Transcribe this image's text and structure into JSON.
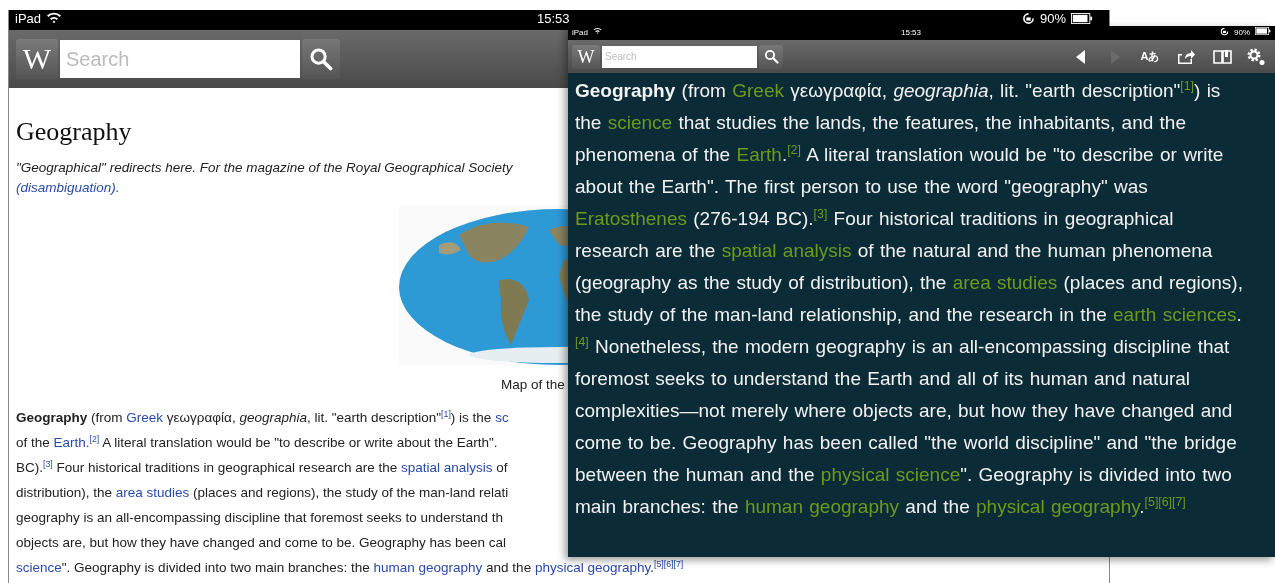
{
  "back_screen": {
    "status_bar": {
      "device": "iPad",
      "time": "15:53",
      "battery": "90%"
    },
    "toolbar": {
      "logo": "W",
      "search": {
        "placeholder": "Search"
      }
    },
    "article": {
      "title": "Geography",
      "hatnote": [
        {
          "kind": "text",
          "text": "\"Geographical\" redirects here. For the magazine of the Royal Geographical Society"
        }
      ],
      "hatnote_link": [
        {
          "kind": "text",
          "text": "(disambiguation)."
        }
      ],
      "figure": {
        "kind": "picture",
        "caption": "Map of the"
      },
      "lines": [
        [
          {
            "kind": "bold",
            "text": "Geography"
          },
          {
            "kind": "text",
            "text": " (from "
          },
          {
            "kind": "link",
            "text": "Greek"
          },
          {
            "kind": "text",
            "text": " γεωγραφία, "
          },
          {
            "kind": "italic",
            "text": "geographia"
          },
          {
            "kind": "text",
            "text": ", lit. \"earth description\""
          },
          {
            "kind": "ref",
            "text": "[1]"
          },
          {
            "kind": "text",
            "text": ") is the "
          },
          {
            "kind": "link",
            "text": "sc"
          }
        ],
        [
          {
            "kind": "text",
            "text": "of the "
          },
          {
            "kind": "link",
            "text": "Earth."
          },
          {
            "kind": "ref",
            "text": "[2]"
          },
          {
            "kind": "text",
            "text": " A literal translation would be \"to describe or write about the Earth\"."
          }
        ],
        [
          {
            "kind": "text",
            "text": "BC)."
          },
          {
            "kind": "ref",
            "text": "[3]"
          },
          {
            "kind": "text",
            "text": " Four historical traditions in geographical research are the "
          },
          {
            "kind": "link",
            "text": "spatial analysis"
          },
          {
            "kind": "text",
            "text": " of"
          }
        ],
        [
          {
            "kind": "text",
            "text": "distribution), the "
          },
          {
            "kind": "link",
            "text": "area studies"
          },
          {
            "kind": "text",
            "text": " (places and regions), the study of the man-land relati"
          }
        ],
        [
          {
            "kind": "text",
            "text": "geography is an all-encompassing discipline that foremost seeks to understand th"
          }
        ],
        [
          {
            "kind": "text",
            "text": "objects are, but how they have changed and come to be. Geography has been cal"
          }
        ],
        [
          {
            "kind": "link",
            "text": "science"
          },
          {
            "kind": "text",
            "text": "\". Geography is divided into two main branches: the "
          },
          {
            "kind": "link",
            "text": "human geography"
          },
          {
            "kind": "text",
            "text": " and the "
          },
          {
            "kind": "link",
            "text": "physical geography"
          },
          {
            "kind": "text",
            "text": "."
          },
          {
            "kind": "ref",
            "text": "[5][6][7]"
          }
        ]
      ]
    }
  },
  "front_screen": {
    "status_bar": {
      "device": "iPad",
      "time": "15:53",
      "battery": "90%"
    },
    "toolbar": {
      "logo": "W",
      "search": {
        "placeholder": "Search"
      },
      "nav": [
        {
          "kind": "back",
          "disabled": false
        },
        {
          "kind": "forward",
          "disabled": true
        }
      ],
      "language_button": "Aあ"
    },
    "paragraph": [
      {
        "kind": "bold",
        "text": "Geography"
      },
      {
        "kind": "text",
        "text": " (from "
      },
      {
        "kind": "link",
        "text": "Greek"
      },
      {
        "kind": "text",
        "text": " γεωγραφία, "
      },
      {
        "kind": "italic",
        "text": "geographia"
      },
      {
        "kind": "text",
        "text": ", lit. \"earth description\""
      },
      {
        "kind": "ref",
        "text": "[1]"
      },
      {
        "kind": "text",
        "text": ") is the "
      },
      {
        "kind": "link",
        "text": "science"
      },
      {
        "kind": "text",
        "text": " that studies the lands, the features, the inhabitants, and the phenomena of the "
      },
      {
        "kind": "link",
        "text": "Earth"
      },
      {
        "kind": "text",
        "text": "."
      },
      {
        "kind": "ref",
        "text": "[2]"
      },
      {
        "kind": "text",
        "text": " A literal translation would be \"to describe or write about the Earth\". The first person to use the word \"geography\" was "
      },
      {
        "kind": "link",
        "text": "Eratosthenes"
      },
      {
        "kind": "text",
        "text": " (276-194 BC)."
      },
      {
        "kind": "ref",
        "text": "[3]"
      },
      {
        "kind": "text",
        "text": " Four historical traditions in geographical research are the "
      },
      {
        "kind": "link",
        "text": "spatial analysis"
      },
      {
        "kind": "text",
        "text": " of the natural and the human phenomena (geography as the study of distribution), the "
      },
      {
        "kind": "link",
        "text": "area studies"
      },
      {
        "kind": "text",
        "text": " (places and regions), the study of the man-land relationship, and the research in the "
      },
      {
        "kind": "link",
        "text": "earth sciences"
      },
      {
        "kind": "text",
        "text": "."
      },
      {
        "kind": "ref",
        "text": "[4]"
      },
      {
        "kind": "text",
        "text": " Nonetheless, the modern geography is an all-encompassing discipline that foremost seeks to understand the Earth and all of its human and natural complexities—not merely where objects are, but how they have changed and come to be. Geography has been called \"the world discipline\" and \"the bridge between the human and the "
      },
      {
        "kind": "link",
        "text": "physical science"
      },
      {
        "kind": "text",
        "text": "\". Geography is divided into two main branches: the "
      },
      {
        "kind": "link",
        "text": "human geography"
      },
      {
        "kind": "text",
        "text": " and the "
      },
      {
        "kind": "link",
        "text": "physical geography"
      },
      {
        "kind": "text",
        "text": "."
      },
      {
        "kind": "ref",
        "text": "[5][6][7]"
      }
    ]
  }
}
